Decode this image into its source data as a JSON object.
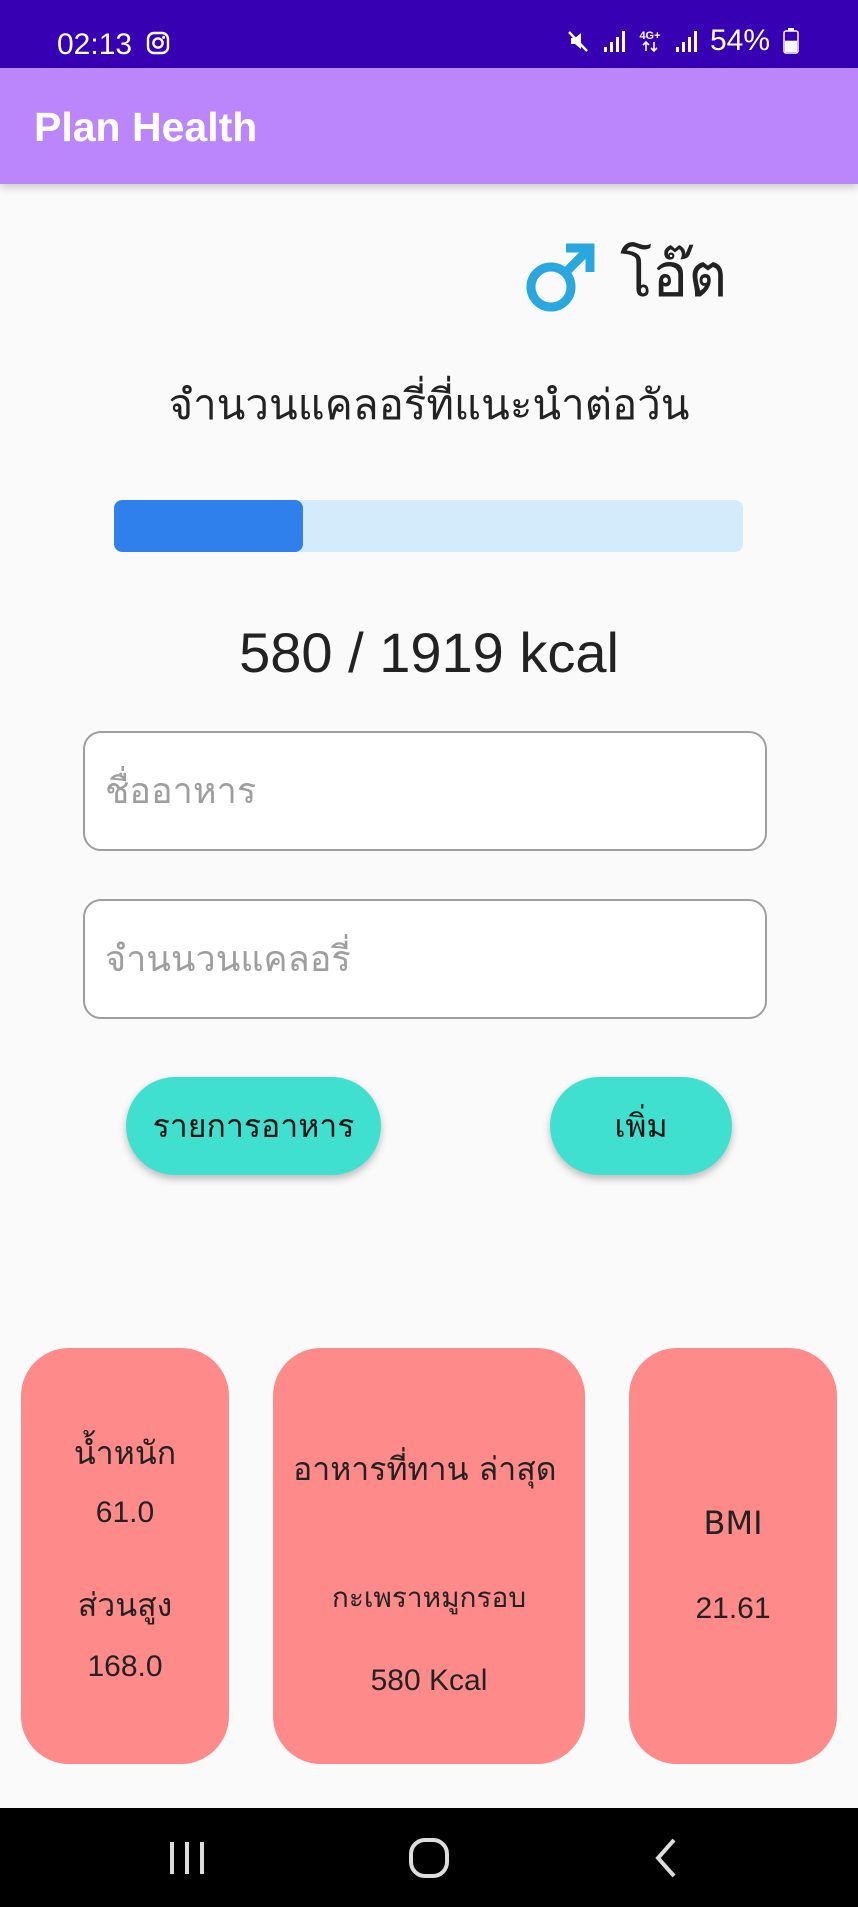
{
  "status_bar": {
    "time": "02:13",
    "battery": "54%",
    "battery_level": 0.54,
    "icons": [
      "instagram-icon",
      "mute-icon",
      "signal-icon",
      "4g-icon",
      "signal-icon",
      "battery-icon"
    ]
  },
  "app_bar": {
    "title": "Plan Health"
  },
  "profile": {
    "gender_icon": "male-symbol-icon",
    "name": "โอ๊ต"
  },
  "calories": {
    "heading": "จำนวนแคลอรี่ที่แนะนำต่อวัน",
    "consumed": 580,
    "target": 1919,
    "readout": "580 / 1919 kcal",
    "progress_fraction": 0.3
  },
  "form": {
    "food_name": {
      "value": "",
      "placeholder": "ชื่ออาหาร"
    },
    "calorie_amount": {
      "value": "",
      "placeholder": "จำนนวนแคลอรี่"
    },
    "food_list_button": "รายการอาหาร",
    "add_button": "เพิ่ม"
  },
  "cards": {
    "body": {
      "weight_label": "น้ำหนัก",
      "weight_value": "61.0",
      "height_label": "ส่วนสูง",
      "height_value": "168.0"
    },
    "recent_food": {
      "title": "อาหารที่ทาน ล่าสุด",
      "food": "กะเพราหมูกรอบ",
      "calories": "580 Kcal"
    },
    "bmi": {
      "label": "BMI",
      "value": "21.61"
    }
  },
  "colors": {
    "status_bar": "#3700b3",
    "app_bar": "#bb86fc",
    "progress_fill": "#2f80ed",
    "progress_track": "#d4ebfb",
    "button": "#40e0d0",
    "card": "#fe8a8a",
    "male_icon": "#29a8e0"
  },
  "nav_bar": {
    "icons": [
      "recent-apps-icon",
      "home-icon",
      "back-icon"
    ]
  }
}
